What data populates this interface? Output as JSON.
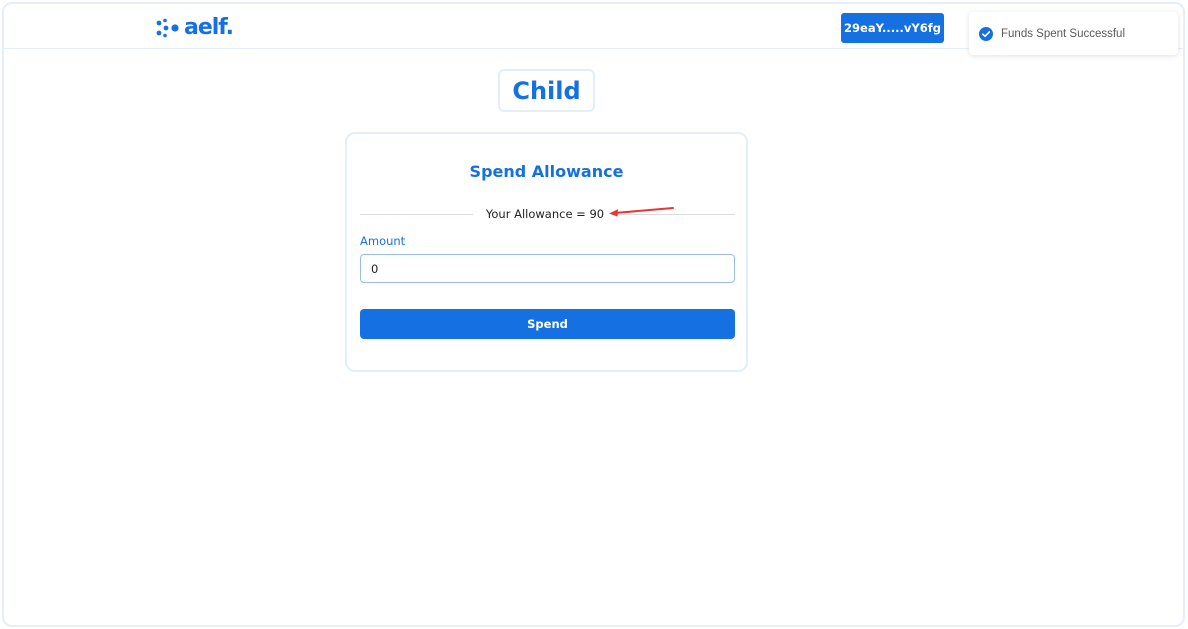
{
  "header": {
    "logo_text": "aelf.",
    "wallet_address": "29eaY.....vY6fg"
  },
  "toast": {
    "icon": "check-circle-icon",
    "message": "Funds Spent Successful"
  },
  "page": {
    "role_title": "Child"
  },
  "card": {
    "title": "Spend Allowance",
    "allowance_text": "Your Allowance = 90",
    "amount_label": "Amount",
    "amount_value": "0",
    "spend_label": "Spend"
  },
  "colors": {
    "accent": "#1570e2",
    "annotation_arrow": "#e53935"
  }
}
